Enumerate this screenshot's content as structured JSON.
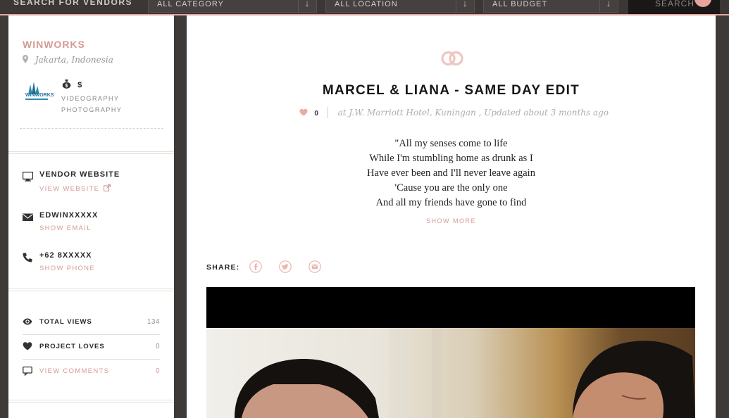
{
  "topbar": {
    "search_label": "SEARCH FOR VENDORS",
    "category_select": "ALL CATEGORY",
    "location_select": "ALL LOCATION",
    "budget_select": "ALL BUDGET",
    "search_button": "SEARCH",
    "accent_color": "#e5a7a0"
  },
  "vendor": {
    "name": "WINWORKS",
    "location": "Jakarta, Indonesia",
    "logo_text": "WINWORKS",
    "price": "$",
    "categories": [
      "VIDEOGRAPHY",
      "PHOTOGRAPHY"
    ]
  },
  "contacts": {
    "website_title": "VENDOR WEBSITE",
    "website_link": "VIEW WEBSITE",
    "email_title": "EDWINXXXXX",
    "email_link": "SHOW EMAIL",
    "phone_title": "+62 8XXXXX",
    "phone_link": "SHOW PHONE"
  },
  "stats": {
    "views_label": "TOTAL VIEWS",
    "views_value": "134",
    "loves_label": "PROJECT LOVES",
    "loves_value": "0",
    "comments_label": "VIEW COMMENTS",
    "comments_value": "0"
  },
  "project": {
    "title": "MARCEL & LIANA - SAME DAY EDIT",
    "love_count": "0",
    "meta": "at J.W. Marriott Hotel, Kuningan , Updated about 3 months ago",
    "lyrics": [
      "\"All my senses come to life",
      "While I'm stumbling home as drunk as I",
      "Have ever been and I'll never leave again",
      "'Cause you are the only one",
      "And all my friends have gone to find"
    ],
    "show_more": "SHOW MORE",
    "share_label": "SHARE:"
  },
  "icons": {
    "rings": "rings-icon",
    "pin": "location-pin-icon",
    "money": "money-bag-icon",
    "monitor": "monitor-icon",
    "envelope": "envelope-icon",
    "phone": "phone-icon",
    "eye": "eye-icon",
    "heart": "heart-icon",
    "comment": "comment-icon",
    "facebook": "facebook-icon",
    "twitter": "twitter-icon",
    "email": "email-share-icon",
    "external": "external-link-icon"
  },
  "colors": {
    "accent_pink": "#d49b94",
    "heart_pink": "#e8a5a0",
    "background": "#3d3a38"
  }
}
